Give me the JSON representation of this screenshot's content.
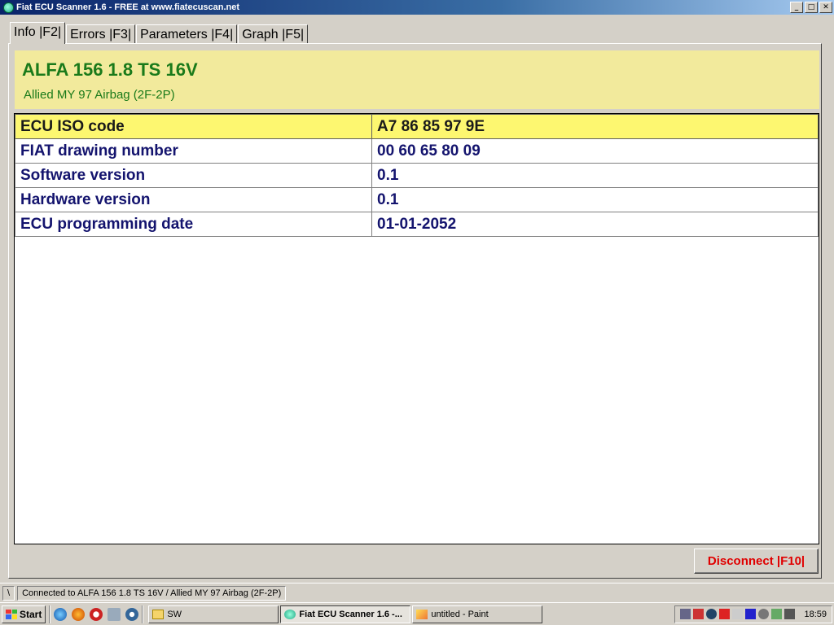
{
  "window": {
    "title": "Fiat ECU Scanner 1.6 - FREE at www.fiatecuscan.net",
    "controls": {
      "minimize": "_",
      "maximize": "□",
      "close": "✕"
    }
  },
  "tabs": [
    {
      "label": "Info |F2|",
      "active": true
    },
    {
      "label": "Errors |F3|",
      "active": false
    },
    {
      "label": "Parameters |F4|",
      "active": false
    },
    {
      "label": "Graph |F5|",
      "active": false
    }
  ],
  "header": {
    "title": "ALFA 156 1.8 TS 16V",
    "subtitle": "Allied MY 97 Airbag (2F-2P)"
  },
  "info_table": [
    {
      "key": "ECU ISO code",
      "value": "A7 86 85 97 9E",
      "selected": true
    },
    {
      "key": "FIAT drawing number",
      "value": "00 60 65 80 09",
      "selected": false
    },
    {
      "key": "Software version",
      "value": "0.1",
      "selected": false
    },
    {
      "key": "Hardware version",
      "value": "0.1",
      "selected": false
    },
    {
      "key": "ECU programming date",
      "value": "01-01-2052",
      "selected": false
    }
  ],
  "disconnect_label": "Disconnect |F10|",
  "statusbar": {
    "indicator": "\\",
    "message": "Connected to ALFA 156 1.8 TS 16V / Allied MY 97 Airbag (2F-2P)"
  },
  "taskbar": {
    "start_label": "Start",
    "buttons": [
      {
        "label": "SW",
        "active": false
      },
      {
        "label": "Fiat ECU Scanner 1.6 -...",
        "active": true
      },
      {
        "label": "untitled - Paint",
        "active": false
      }
    ],
    "clock": "18:59"
  },
  "colors": {
    "header_bg": "#f2ea9c",
    "header_text": "#1a7a1a",
    "table_text": "#14146e",
    "selected_row": "#fdf770",
    "disconnect_text": "#e00000",
    "titlebar": "#0a246a"
  }
}
